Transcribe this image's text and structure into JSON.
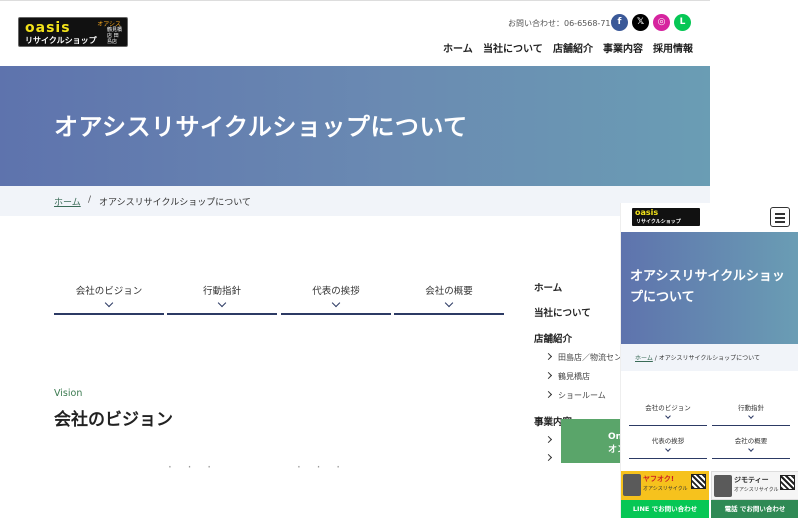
{
  "header": {
    "logo": {
      "main": "oasis",
      "kana": "オアシス",
      "sub": "リサイクルショップ",
      "shops": "鶴見橋店 田島店"
    },
    "contact_label": "お問い合わせ：",
    "contact_phone": "06-6568-7179",
    "social": [
      {
        "name": "facebook",
        "glyph": "f"
      },
      {
        "name": "x",
        "glyph": "𝕏"
      },
      {
        "name": "instagram",
        "glyph": "◎"
      },
      {
        "name": "line",
        "glyph": "L"
      }
    ],
    "nav": [
      "ホーム",
      "当社について",
      "店舗紹介",
      "事業内容",
      "採用情報"
    ]
  },
  "hero": {
    "title": "オアシスリサイクルショップについて"
  },
  "breadcrumb": {
    "home": "ホーム",
    "separator": "/",
    "current": "オアシスリサイクルショップについて"
  },
  "tabs": [
    "会社のビジョン",
    "行動指針",
    "代表の挨拶",
    "会社の概要"
  ],
  "sidebar": {
    "items": [
      "ホーム",
      "当社について",
      "店舗紹介",
      "事業内容"
    ],
    "store_subitems": [
      "田島店／物流セン",
      "鶴見橋店",
      "ショールーム"
    ]
  },
  "vision": {
    "en": "Vision",
    "jp": "会社のビジョン"
  },
  "online_button": {
    "line1": "On",
    "line2": "オンラ"
  },
  "mobile": {
    "logo": {
      "main": "oasis",
      "sub": "リサイクルショップ"
    },
    "hero_title": "オアシスリサイクルショップについて",
    "breadcrumb_home": "ホーム",
    "breadcrumb_sep": "/",
    "breadcrumb_current": "オアシスリサイクルショップについて",
    "tabs": [
      "会社のビジョン",
      "行動指針",
      "代表の挨拶",
      "会社の概要"
    ],
    "banner_left": {
      "title": "ヤフオク!",
      "sub": "オアシスリサイクル"
    },
    "banner_right": {
      "title": "ジモティー",
      "sub": "オアシスリサイクル"
    },
    "line_button": "LINE でお問い合わせ",
    "tel_button": "電話 でお問い合わせ"
  },
  "colors": {
    "accent": "#2c3a64",
    "hero_start": "#5e73ad",
    "hero_end": "#6a9db4",
    "green": "#3a7a4f"
  }
}
